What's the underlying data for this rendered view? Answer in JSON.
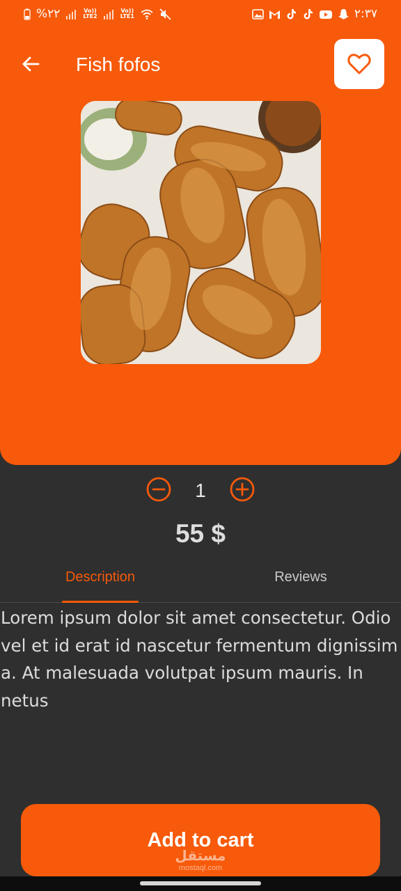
{
  "status_bar": {
    "battery_text": "%٢٢",
    "sim1_label": "LTE2",
    "sim2_label": "LTE1",
    "volte": "Vo))",
    "time": "٢:٣٧",
    "icons": [
      "battery-icon",
      "signal-icon",
      "wifi-icon",
      "mute-icon",
      "gallery-icon",
      "gmail-icon",
      "tiktok-icon",
      "youtube-icon",
      "snapchat-icon"
    ]
  },
  "header": {
    "title": "Fish fofos",
    "back_icon": "arrow-left-icon",
    "favorite_icon": "heart-icon"
  },
  "product": {
    "image_alt": "fried fish croquettes",
    "quantity": "1",
    "price": "55 $"
  },
  "tabs": [
    {
      "label": "Description",
      "active": true
    },
    {
      "label": "Reviews",
      "active": false
    }
  ],
  "description": "Lorem ipsum dolor sit amet consectetur. Odio vel et id erat id nascetur fermentum dignissim a. At malesuada volutpat ipsum mauris. In netus",
  "cart_button": {
    "label": "Add to cart"
  },
  "watermark": {
    "logo": "مستقل",
    "site": "mostaql.com"
  },
  "colors": {
    "accent": "#f75a0a",
    "background": "#2f2f2f",
    "text_light": "#dcdcdc"
  }
}
